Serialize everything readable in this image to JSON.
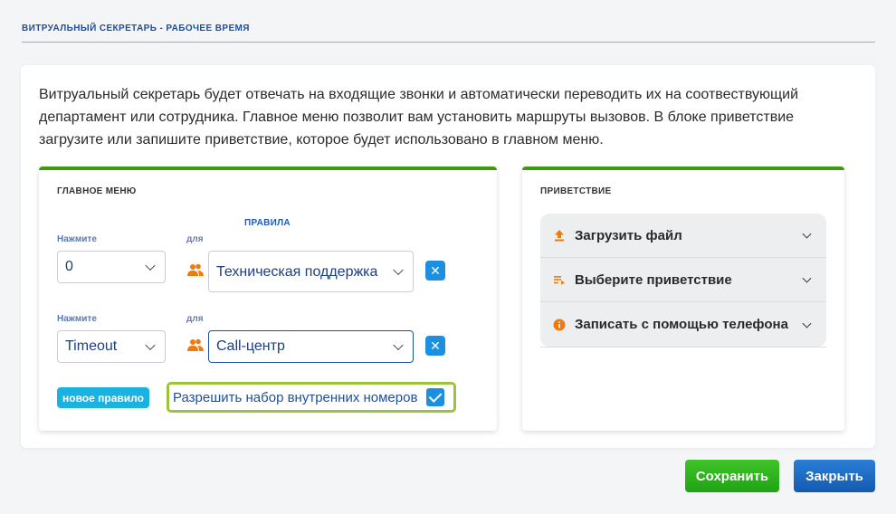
{
  "dialog": {
    "title": "ВИТРУАЛЬНЫЙ СЕКРЕТАРЬ - РАБОЧЕЕ ВРЕМЯ",
    "intro": "Витруальный секретарь будет отвечать на входящие звонки и автоматически переводить их на соотвествующий департамент или сотрудника. Главное меню позволит вам установить маршруты вызовов. В блоке приветствие загрузите или запишите приветствие, которое будет использовано в главном меню."
  },
  "main_menu": {
    "title": "ГЛАВНОЕ МЕНЮ",
    "rules_header": "ПРАВИЛА",
    "rules": [
      {
        "press_label": "Нажмите",
        "press_value": "0",
        "for_label": "для",
        "target": "Техническая поддержка",
        "remove_glyph": "✕"
      },
      {
        "press_label": "Нажмите",
        "press_value": "Timeout",
        "for_label": "для",
        "target": "Call-центр",
        "remove_glyph": "✕"
      }
    ],
    "new_rule_label": "новое правило",
    "allow_internal_label": "Разрешить набор внутренних номеров",
    "allow_internal_checked": true
  },
  "greeting": {
    "title": "ПРИВЕТСТВИЕ",
    "items": [
      {
        "label": "Загрузить файл",
        "icon": "upload-icon"
      },
      {
        "label": "Выберите приветствие",
        "icon": "playlist-icon"
      },
      {
        "label": "Записать с помощью телефона",
        "icon": "info-icon"
      }
    ]
  },
  "footer": {
    "save_label": "Сохранить",
    "close_label": "Закрыть"
  },
  "colors": {
    "accent_green": "#3f9a10",
    "accent_blue": "#1d8fe0",
    "highlight": "#9cc43a",
    "icon_orange": "#f07a0e"
  }
}
